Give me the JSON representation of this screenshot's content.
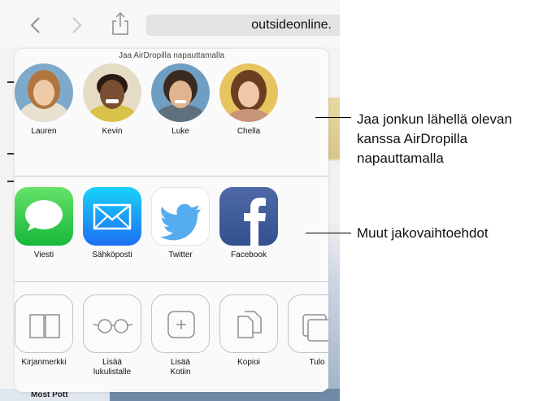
{
  "browser": {
    "address_text": "outsideonline.",
    "back_icon": "chevron-left-icon",
    "forward_icon": "chevron-right-icon",
    "share_icon": "share-icon",
    "page_footer_text": "Most Pott"
  },
  "share_sheet": {
    "airdrop_title": "Jaa AirDropilla napauttamalla",
    "people": [
      {
        "name": "Lauren",
        "avatar_color": "#d9b07a"
      },
      {
        "name": "Kevin",
        "avatar_color": "#6b4630"
      },
      {
        "name": "Luke",
        "avatar_color": "#c89a6e"
      },
      {
        "name": "Chella",
        "avatar_color": "#c98f5e"
      }
    ],
    "apps": [
      {
        "name": "Viesti",
        "icon": "messages-icon",
        "color": "#34c759"
      },
      {
        "name": "Sähköposti",
        "icon": "mail-icon",
        "color": "#1c8ef9"
      },
      {
        "name": "Twitter",
        "icon": "twitter-icon",
        "color": "#55acee"
      },
      {
        "name": "Facebook",
        "icon": "facebook-icon",
        "color": "#3b5998"
      }
    ],
    "actions": [
      {
        "name": "Kirjanmerkki",
        "icon": "book-icon"
      },
      {
        "name": "Lisää lukulistalle",
        "line1": "Lisää",
        "line2": "lukulistalle",
        "icon": "glasses-icon"
      },
      {
        "name": "Lisää Kotiin",
        "line1": "Lisää",
        "line2": "Kotiin",
        "icon": "add-icon"
      },
      {
        "name": "Kopioi",
        "icon": "copy-icon"
      },
      {
        "name": "Tulo",
        "icon": "print-icon"
      }
    ]
  },
  "callouts": {
    "airdrop_line1": "Jaa jonkun lähellä olevan",
    "airdrop_line2": "kanssa AirDropilla",
    "airdrop_line3": "napauttamalla",
    "other": "Muut jakovaihtoehdot"
  }
}
